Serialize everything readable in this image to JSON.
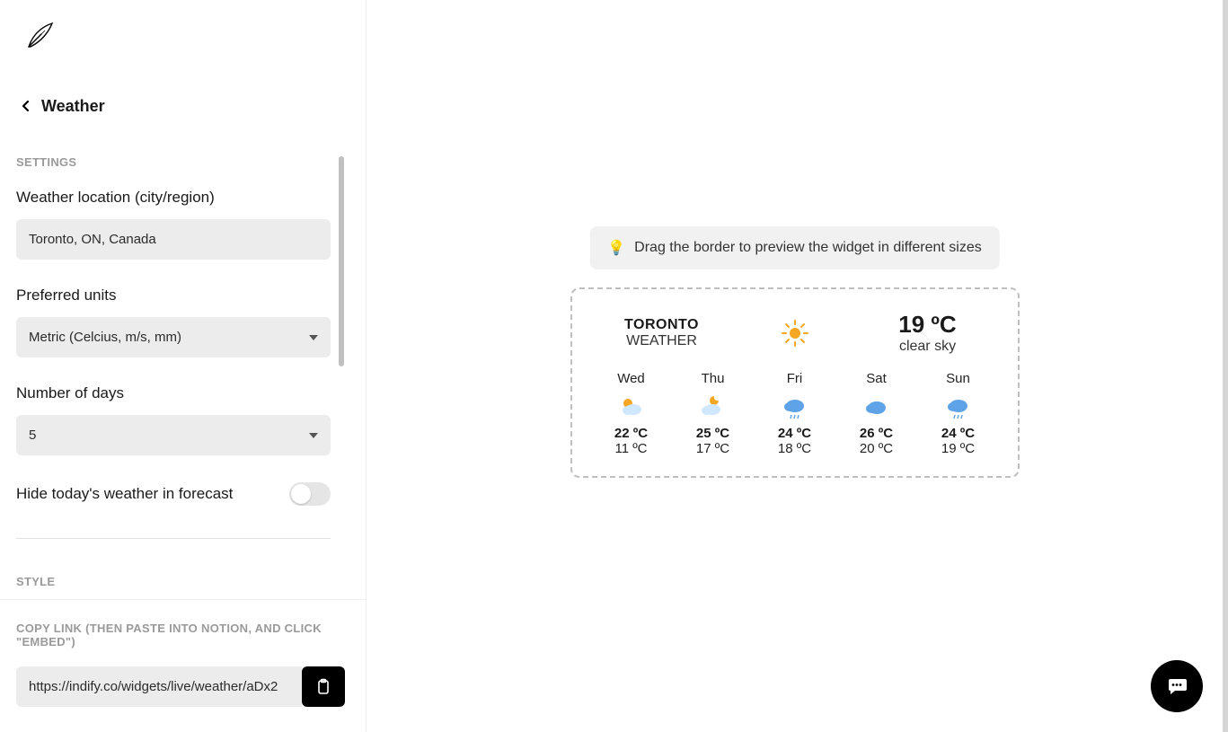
{
  "header": {
    "title": "Weather"
  },
  "sections": {
    "settings_label": "SETTINGS",
    "style_label": "STYLE",
    "copy_label": "COPY LINK (THEN PASTE INTO NOTION, AND CLICK \"EMBED\")"
  },
  "settings": {
    "location_label": "Weather location (city/region)",
    "location_value": "Toronto, ON, Canada",
    "units_label": "Preferred units",
    "units_value": "Metric (Celcius, m/s, mm)",
    "days_label": "Number of days",
    "days_value": "5",
    "hide_today_label": "Hide today's weather in forecast",
    "hide_today_on": false
  },
  "copy": {
    "url": "https://indify.co/widgets/live/weather/aDx2"
  },
  "hint": {
    "icon": "💡",
    "text": "Drag the border to preview the widget in different sizes"
  },
  "widget": {
    "city": "TORONTO",
    "subtitle": "WEATHER",
    "current_temp": "19 ºC",
    "current_desc": "clear sky",
    "current_icon": "sun",
    "forecast": [
      {
        "day": "Wed",
        "icon": "sun-cloud",
        "high": "22 ºC",
        "low": "11 ºC"
      },
      {
        "day": "Thu",
        "icon": "moon-cloud",
        "high": "25 ºC",
        "low": "17 ºC"
      },
      {
        "day": "Fri",
        "icon": "cloud-rain",
        "high": "24 ºC",
        "low": "18 ºC"
      },
      {
        "day": "Sat",
        "icon": "cloud",
        "high": "26 ºC",
        "low": "20 ºC"
      },
      {
        "day": "Sun",
        "icon": "cloud-rain",
        "high": "24 ºC",
        "low": "19 ºC"
      }
    ]
  }
}
